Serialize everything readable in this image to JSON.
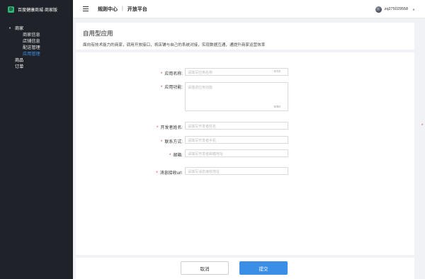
{
  "brand": {
    "logo_glyph": "D",
    "name": "百度健康商城·商家版"
  },
  "sidebar": {
    "groups": [
      {
        "label": "商家",
        "expanded": true
      },
      {
        "label": "商品"
      },
      {
        "label": "订单"
      }
    ],
    "sub_items": [
      {
        "label": "商家信息"
      },
      {
        "label": "店铺信息"
      },
      {
        "label": "配送管理"
      },
      {
        "label": "应用管理",
        "active": true
      }
    ]
  },
  "header": {
    "title_main": "规则中心",
    "separator": "|",
    "title_sub": "开放平台",
    "username": "zq275029558"
  },
  "page": {
    "title": "自用型应用",
    "description": "面向有技术能力的商家，调用开放接口，将店铺与自己的系统对接，实现数据互通，通提升商家运营效率"
  },
  "form": {
    "required_mark": "*",
    "fields": [
      {
        "label": "应用名称:",
        "placeholder": "请填写应用名称",
        "counter": "0/12"
      },
      {
        "label": "应用功能:",
        "placeholder": "请描述应用功能",
        "counter": "0/60"
      },
      {
        "label": "开发者姓名:",
        "placeholder": "请填写开发者姓名"
      },
      {
        "label": "联系方式:",
        "placeholder": "请填写开发者手机"
      },
      {
        "label": "邮箱:",
        "placeholder": "请填写开发者邮箱地址"
      },
      {
        "label": "消息接收url:",
        "placeholder": "请填写消息接收地址"
      }
    ]
  },
  "footer": {
    "cancel_label": "取消",
    "submit_label": "提交"
  },
  "colors": {
    "accent": "#3a8ee6",
    "sidebar_bg": "#1f2329",
    "required": "#f5222d",
    "brand_logo": "#2bb673"
  },
  "icons": [
    "menu-icon",
    "avatar",
    "chevron-down-icon",
    "caret-down-icon"
  ]
}
